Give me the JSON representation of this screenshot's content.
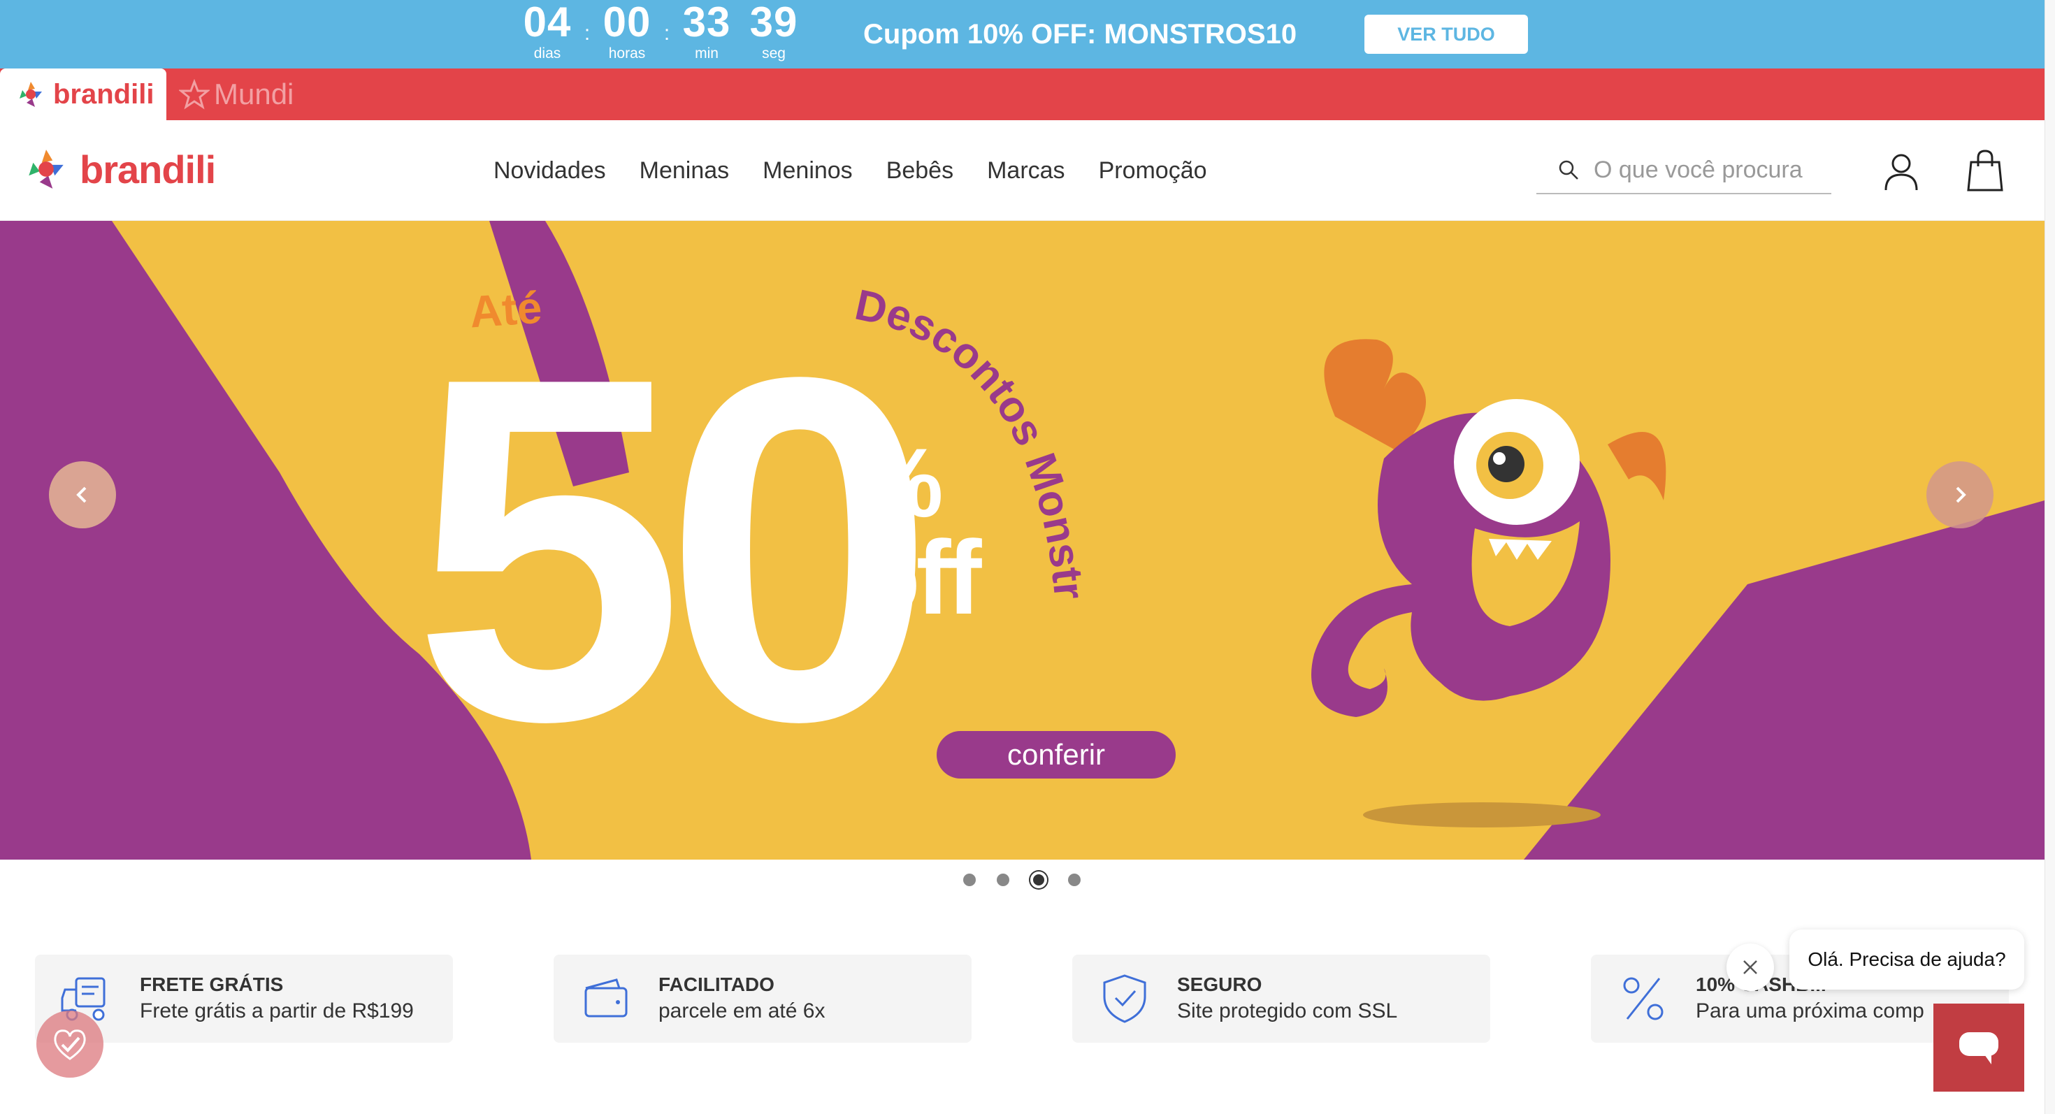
{
  "promo": {
    "countdown": [
      {
        "value": "04",
        "label": "dias"
      },
      {
        "value": "00",
        "label": "horas"
      },
      {
        "value": "33",
        "label": "min"
      },
      {
        "value": "39",
        "label": "seg"
      }
    ],
    "separator": ":",
    "coupon": "Cupom 10% OFF: MONSTROS10",
    "cta": "VER TUDO",
    "bg_color": "#5db6e2"
  },
  "stores": {
    "brandili": "brandili",
    "mundi": "Mundi",
    "bar_color": "#e34449"
  },
  "header": {
    "logo": "brandili",
    "nav": [
      "Novidades",
      "Meninas",
      "Meninos",
      "Bebês",
      "Marcas",
      "Promoção"
    ],
    "search_placeholder": "O que você procura",
    "icons": [
      "search-icon",
      "user-icon",
      "bag-icon"
    ]
  },
  "hero": {
    "until": "Até",
    "amount": "50",
    "percent": "%",
    "off": "off",
    "curved_text": "Descontos Monstros",
    "cta": "conferir",
    "slides_total": 4,
    "active_slide": 3,
    "colors": {
      "yellow": "#f2c044",
      "purple": "#993a8b",
      "orange": "#f08a2e"
    }
  },
  "features": [
    {
      "icon": "truck-icon",
      "title": "FRETE GRÁTIS",
      "subtitle": "Frete grátis a partir de R$199"
    },
    {
      "icon": "wallet-icon",
      "title": "FACILITADO",
      "subtitle": "parcele em até 6x"
    },
    {
      "icon": "shield-check-icon",
      "title": "SEGURO",
      "subtitle": "Site protegido com SSL"
    },
    {
      "icon": "percent-icon",
      "title": "10% CASHB...",
      "subtitle": "Para uma próxima comp"
    }
  ],
  "chat": {
    "greeting": "Olá. Precisa de ajuda?"
  }
}
